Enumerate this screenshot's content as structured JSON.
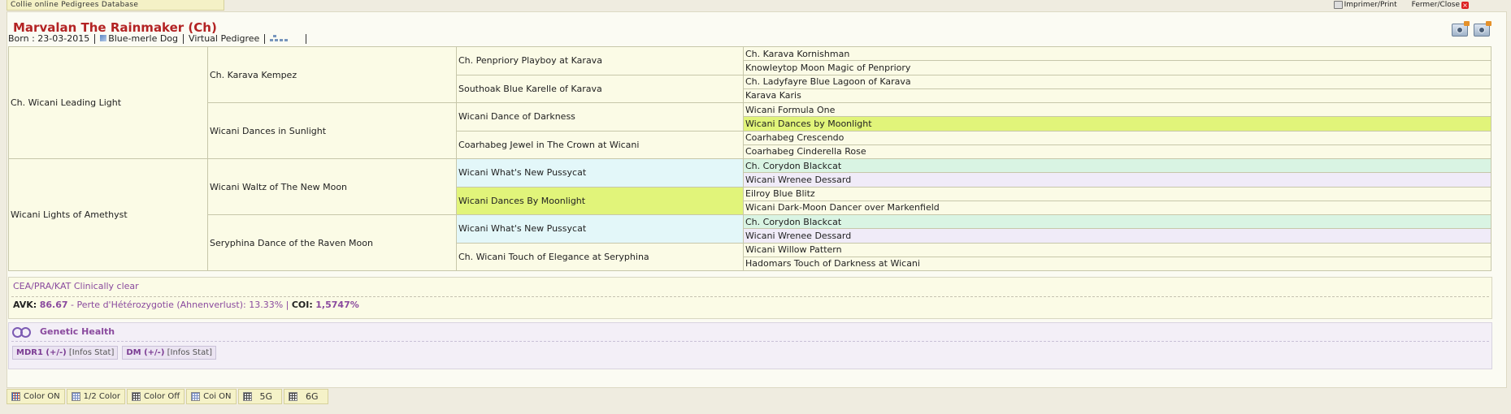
{
  "app": {
    "title": "Collie online Pedigrees Database",
    "print_label": "Imprimer/Print",
    "close_label": "Fermer/Close"
  },
  "dog": {
    "name": "Marvalan The Rainmaker (Ch)",
    "born": "Born : 23-03-2015",
    "color": "Blue-merle Dog",
    "virtual_pedigree": "Virtual Pedigree"
  },
  "pedigree": {
    "gen1": [
      "Ch. Wicani Leading Light",
      "Wicani Lights of Amethyst"
    ],
    "gen2": [
      "Ch. Karava Kempez",
      "Wicani Dances in Sunlight",
      "Wicani Waltz of The New Moon",
      "Seryphina Dance of the Raven Moon"
    ],
    "gen3": [
      "Ch. Penpriory Playboy at Karava",
      "Southoak Blue Karelle of Karava",
      "Wicani Dance of Darkness",
      "Coarhabeg Jewel in The Crown at Wicani",
      "Wicani What's New Pussycat",
      "Wicani Dances By Moonlight",
      "Wicani What's New Pussycat",
      "Ch. Wicani Touch of Elegance at Seryphina"
    ],
    "gen4": [
      "Ch. Karava Kornishman",
      "Knowleytop Moon Magic of Penpriory",
      "Ch. Ladyfayre Blue Lagoon of Karava",
      "Karava Karis",
      "Wicani Formula One",
      "Wicani Dances by Moonlight",
      "Coarhabeg Crescendo",
      "Coarhabeg Cinderella Rose",
      "Ch. Corydon Blackcat",
      "Wicani Wrenee Dessard",
      "Eilroy Blue Blitz",
      "Wicani Dark-Moon Dancer over Markenfield",
      "Ch. Corydon Blackcat",
      "Wicani Wrenee Dessard",
      "Wicani Willow Pattern",
      "Hadomars Touch of Darkness at Wicani"
    ],
    "highlight_colors": {
      "cyan": "#e3f7f9",
      "lime": "#e1f47a",
      "mint": "#d9f4e3",
      "lilac": "#f0ebf8",
      "default": "#fbfbe6"
    }
  },
  "health": {
    "clear": "CEA/PRA/KAT Clinically clear",
    "avk_label": "AVK:",
    "avk_value": "86.67",
    "loss_label": "- Perte d'Hétérozygotie (Ahnenverlust): 13.33% |",
    "coi_label": "COI:",
    "coi_value": "1,5747%"
  },
  "genetic": {
    "title": "Genetic Health",
    "tests": [
      {
        "name": "MDR1 (+/-)",
        "info": "[Infos  Stat]"
      },
      {
        "name": "DM (+/-)",
        "info": "[Infos  Stat]"
      }
    ]
  },
  "bottombar": {
    "color_on": "Color ON",
    "half_color": "1/2 Color",
    "color_off": "Color Off",
    "coi_on": "Coi ON",
    "gen5": "5G",
    "gen6": "6G"
  }
}
